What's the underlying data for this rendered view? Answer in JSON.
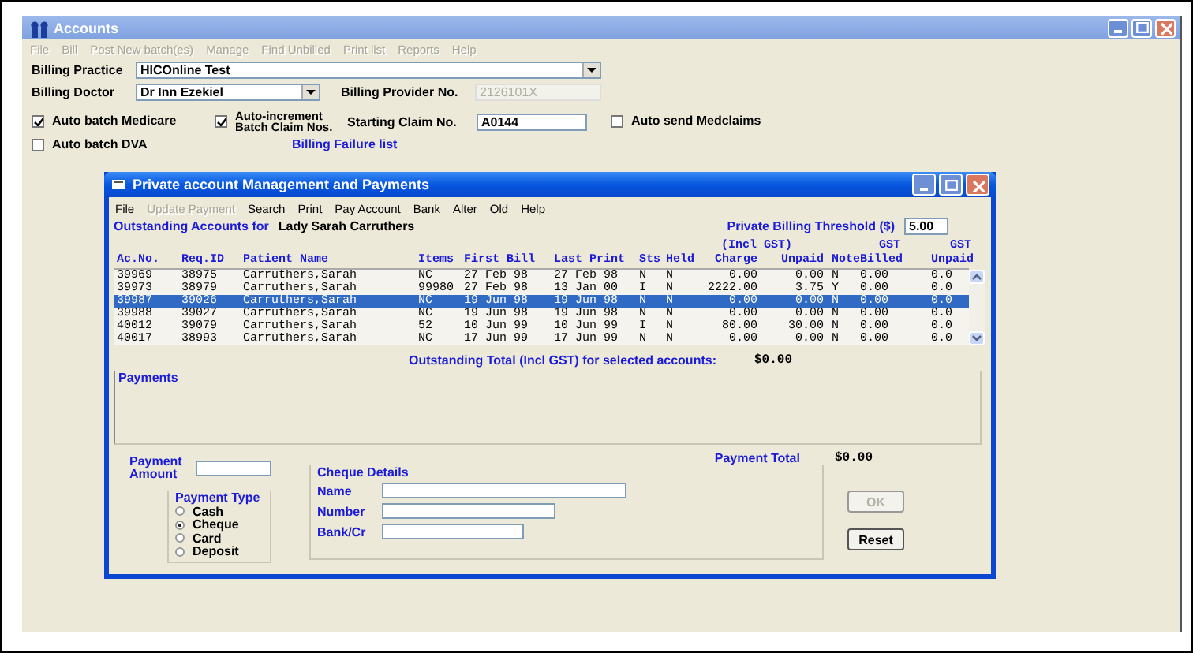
{
  "window": {
    "title": "Accounts",
    "active": false
  },
  "menu": [
    {
      "label": "File",
      "disabled": true
    },
    {
      "label": "Bill",
      "disabled": true
    },
    {
      "label": "Post New batch(es)",
      "disabled": true
    },
    {
      "label": "Manage",
      "disabled": true
    },
    {
      "label": "Find Unbilled",
      "disabled": true
    },
    {
      "label": "Print list",
      "disabled": true
    },
    {
      "label": "Reports",
      "disabled": true
    },
    {
      "label": "Help",
      "disabled": true
    }
  ],
  "form": {
    "billing_practice": {
      "label": "Billing Practice",
      "value": "HICOnline Test"
    },
    "billing_doctor": {
      "label": "Billing Doctor",
      "value": "Dr Inn Ezekiel"
    },
    "provider_no": {
      "label": "Billing Provider No.",
      "value": "2126101X",
      "disabled": true
    },
    "starting_claim": {
      "label": "Starting Claim No.",
      "value": "A0144"
    },
    "checkboxes": [
      {
        "label": "Auto batch Medicare",
        "checked": true
      },
      {
        "label": "Auto-increment Batch Claim Nos.",
        "checked": true
      },
      {
        "label": "Auto send Medclaims",
        "checked": false
      },
      {
        "label": "Auto batch DVA",
        "checked": false
      }
    ],
    "link": "Billing Failure list"
  },
  "dialog": {
    "title": "Private account Management and Payments",
    "menu": [
      {
        "label": "File",
        "disabled": false
      },
      {
        "label": "Update Payment",
        "disabled": true
      },
      {
        "label": "Search",
        "disabled": false
      },
      {
        "label": "Print",
        "disabled": false
      },
      {
        "label": "Pay Account",
        "disabled": false
      },
      {
        "label": "Bank",
        "disabled": false
      },
      {
        "label": "Alter",
        "disabled": false
      },
      {
        "label": "Old",
        "disabled": false
      },
      {
        "label": "Help",
        "disabled": false
      }
    ],
    "outstanding_label": "Outstanding Accounts for",
    "patient": "Lady Sarah Carruthers",
    "threshold": {
      "label": "Private Billing Threshold ($)",
      "value": "5.00"
    },
    "table": {
      "columns": [
        {
          "label": "Ac.No."
        },
        {
          "label": "Req.ID"
        },
        {
          "label": "Patient Name"
        },
        {
          "label": "Items"
        },
        {
          "label": "First Bill"
        },
        {
          "label": "Last Print"
        },
        {
          "label": "Sts"
        },
        {
          "label": "Held"
        },
        {
          "label": "Charge",
          "group": "(Incl GST)"
        },
        {
          "label": "Unpaid"
        },
        {
          "label": "Note"
        },
        {
          "label": "Billed",
          "group": "GST"
        },
        {
          "label": "Unpaid",
          "group": "GST"
        }
      ],
      "rows": [
        {
          "selected": false,
          "cells": [
            "39969",
            "38975",
            "Carruthers,Sarah",
            "NC",
            "27 Feb 98",
            "27 Feb 98",
            "N",
            "N",
            "0.00",
            "0.00",
            "N",
            "0.00",
            "0.0"
          ]
        },
        {
          "selected": false,
          "cells": [
            "39973",
            "38979",
            "Carruthers,Sarah",
            "99980",
            "27 Feb 98",
            "13 Jan 00",
            "I",
            "N",
            "2222.00",
            "3.75",
            "Y",
            "0.00",
            "0.0"
          ]
        },
        {
          "selected": true,
          "cells": [
            "39987",
            "39026",
            "Carruthers,Sarah",
            "NC",
            "19 Jun 98",
            "19 Jun 98",
            "N",
            "N",
            "0.00",
            "0.00",
            "N",
            "0.00",
            "0.0"
          ]
        },
        {
          "selected": false,
          "cells": [
            "39988",
            "39027",
            "Carruthers,Sarah",
            "NC",
            "19 Jun 98",
            "19 Jun 98",
            "N",
            "N",
            "0.00",
            "0.00",
            "N",
            "0.00",
            "0.0"
          ]
        },
        {
          "selected": false,
          "cells": [
            "40012",
            "39079",
            "Carruthers,Sarah",
            "52",
            "10 Jun 99",
            "10 Jun 99",
            "I",
            "N",
            "80.00",
            "30.00",
            "N",
            "0.00",
            "0.0"
          ]
        },
        {
          "selected": false,
          "cells": [
            "40017",
            "38993",
            "Carruthers,Sarah",
            "NC",
            "17 Jun 99",
            "17 Jun 99",
            "N",
            "N",
            "0.00",
            "0.00",
            "N",
            "0.00",
            "0.0"
          ]
        }
      ]
    },
    "total": {
      "label": "Outstanding Total (Incl GST) for selected accounts:",
      "value": "$0.00"
    },
    "payments_label": "Payments",
    "payment_amount": {
      "label": "Payment Amount"
    },
    "payment_type": {
      "label": "Payment Type",
      "options": [
        {
          "label": "Cash",
          "selected": false
        },
        {
          "label": "Cheque",
          "selected": true
        },
        {
          "label": "Card",
          "selected": false
        },
        {
          "label": "Deposit",
          "selected": false
        }
      ]
    },
    "cheque": {
      "label": "Cheque Details",
      "fields": [
        {
          "label": "Name"
        },
        {
          "label": "Number"
        },
        {
          "label": "Bank/Cr"
        }
      ]
    },
    "payment_total": {
      "label": "Payment Total",
      "value": "$0.00"
    },
    "buttons": [
      {
        "label": "OK",
        "disabled": true
      },
      {
        "label": "Reset",
        "disabled": false
      }
    ]
  }
}
